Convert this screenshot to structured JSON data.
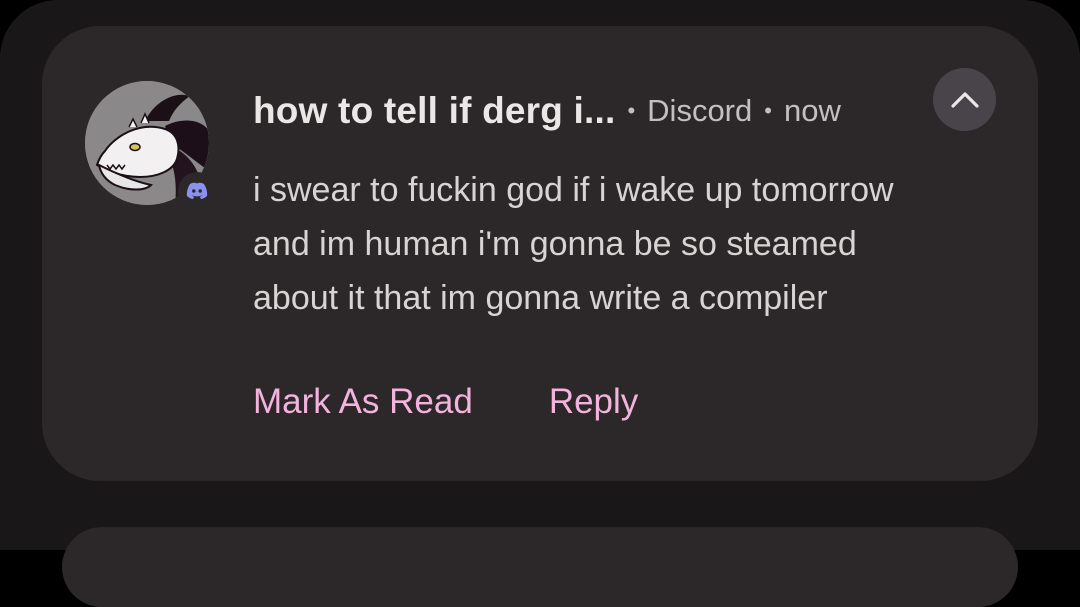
{
  "notification": {
    "title": "how to tell if derg i...",
    "app_name": "Discord",
    "separator": "•",
    "time": "now",
    "message_lines": [
      "i swear to fuckin god if i wake up tomorrow",
      "and im human i'm gonna be so steamed",
      "about it that im gonna write a compiler"
    ],
    "actions": {
      "mark_as_read": "Mark As Read",
      "reply": "Reply"
    },
    "avatar_icon": "dragon-avatar",
    "app_icon": "discord-icon",
    "expand_icon": "chevron-up-icon"
  },
  "colors": {
    "background": "#000000",
    "card": "#2c2829",
    "action_text": "#f2b3dc",
    "discord_badge": "#8c90f0"
  }
}
